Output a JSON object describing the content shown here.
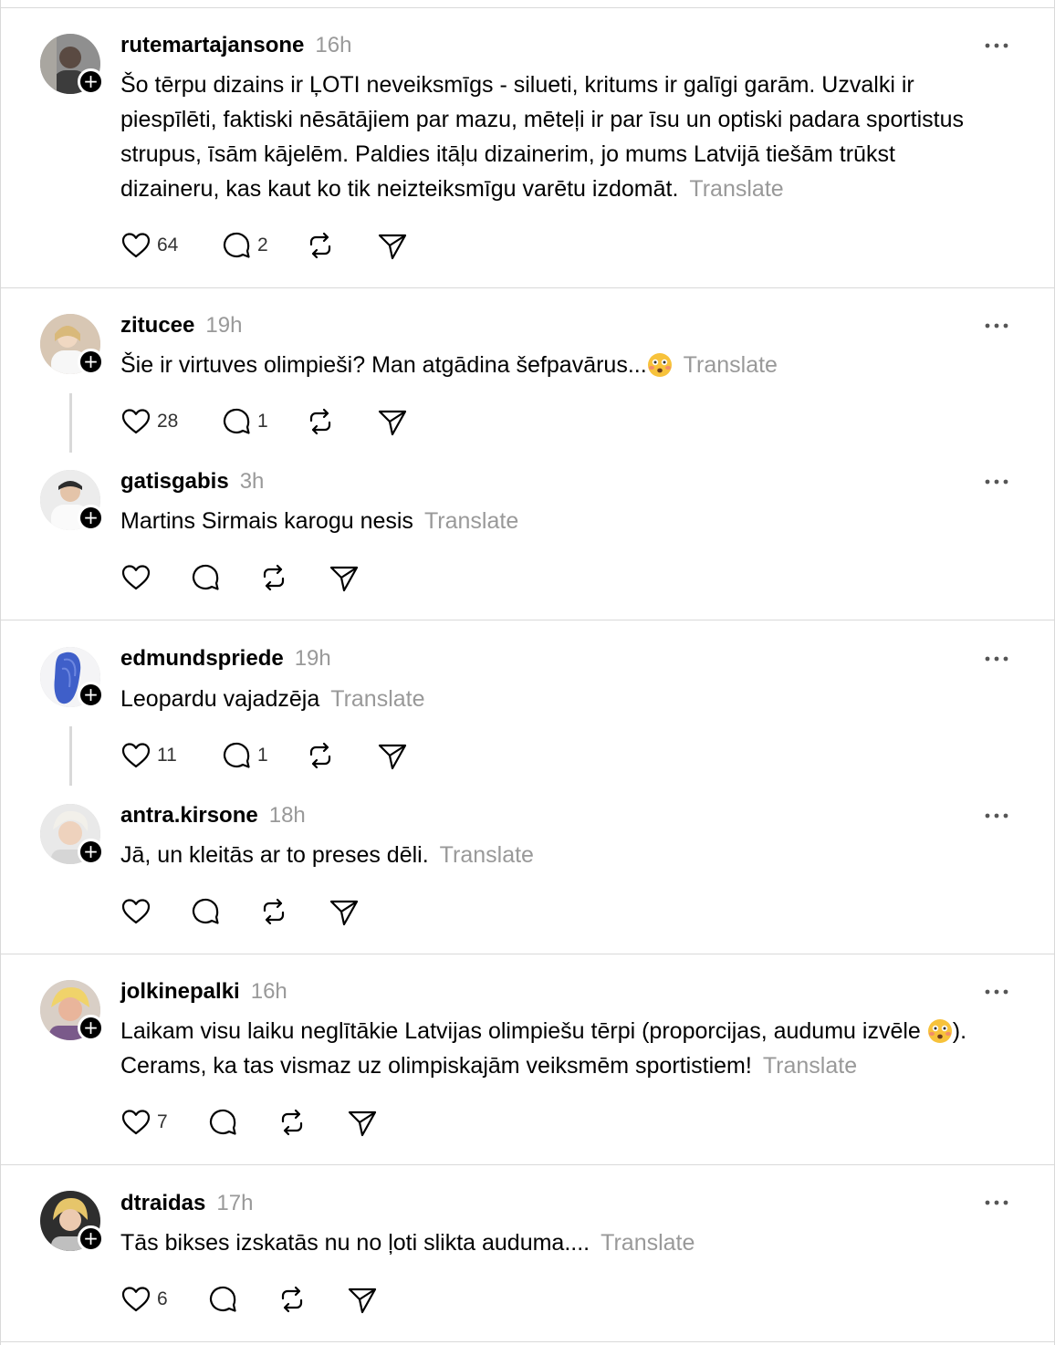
{
  "translate_label": "Translate",
  "posts": [
    {
      "username": "rutemartajansone",
      "time": "16h",
      "text": "Šo tērpu dizains ir ĻOTI neveiksmīgs - silueti, kritums ir galīgi garām. Uzvalki ir piespīlēti, faktiski nēsātājiem par mazu, mēteļi ir par īsu un optiski padara sportistus strupus, īsām kājelēm. Paldies itāļu dizainerim, jo mums Latvijā tiešām trūkst dizaineru, kas kaut ko tik neizteiksmīgu varētu izdomāt.",
      "likes": "64",
      "replies": "2"
    },
    {
      "username": "zitucee",
      "time": "19h",
      "text": "Šie ir virtuves olimpieši? Man atgādina šefpavārus...",
      "likes": "28",
      "replies": "1"
    },
    {
      "username": "gatisgabis",
      "time": "3h",
      "text": "Martins Sirmais karogu nesis",
      "likes": "",
      "replies": ""
    },
    {
      "username": "edmundspriede",
      "time": "19h",
      "text": "Leopardu vajadzēja",
      "likes": "11",
      "replies": "1"
    },
    {
      "username": "antra.kirsone",
      "time": "18h",
      "text": "Jā, un kleitās ar to preses dēli.",
      "likes": "",
      "replies": ""
    },
    {
      "username": "jolkinepalki",
      "time": "16h",
      "text_a": "Laikam visu laiku neglītākie Latvijas olimpiešu tērpi (proporcijas, audumu izvēle",
      "text_b": "). Cerams, ka tas vismaz uz olimpiskajām veiksmēm sportistiem!",
      "likes": "7",
      "replies": ""
    },
    {
      "username": "dtraidas",
      "time": "17h",
      "text": "Tās bikses izskatās nu no ļoti slikta auduma....",
      "likes": "6",
      "replies": ""
    }
  ],
  "icons": {
    "like": "heart-icon",
    "reply": "comment-icon",
    "repost": "repost-icon",
    "share": "send-icon",
    "more": "more-icon",
    "follow": "plus-icon",
    "emoji": "flushed-face-emoji"
  },
  "colors": {
    "muted": "#999999",
    "text": "#000000",
    "divider": "#d9d9d9"
  }
}
